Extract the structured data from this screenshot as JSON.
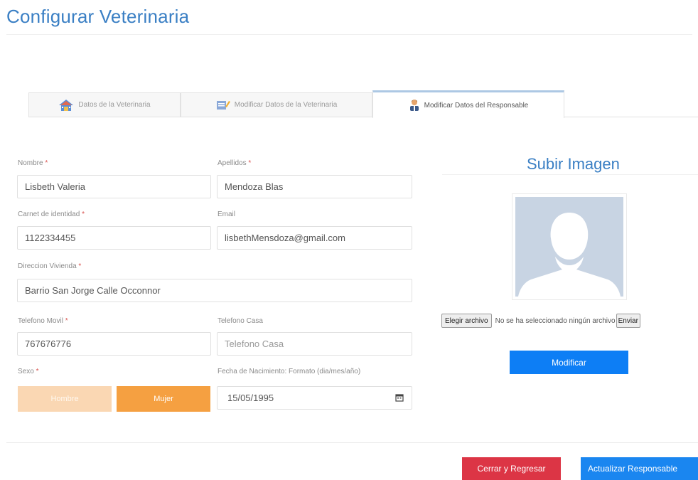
{
  "page": {
    "title": "Configurar Veterinaria"
  },
  "tabs": [
    {
      "label": "Datos de la Veterinaria",
      "icon": "house-icon",
      "active": false
    },
    {
      "label": "Modificar Datos de la Veterinaria",
      "icon": "edit-document-icon",
      "active": false
    },
    {
      "label": "Modificar Datos del Responsable",
      "icon": "user-icon",
      "active": true
    }
  ],
  "form": {
    "nombre": {
      "label": "Nombre",
      "value": "Lisbeth Valeria",
      "required": "*"
    },
    "apellidos": {
      "label": "Apellidos",
      "value": "Mendoza Blas",
      "required": "*"
    },
    "carnet": {
      "label": "Carnet de identidad",
      "value": "1122334455",
      "required": "*"
    },
    "email": {
      "label": "Email",
      "value": "lisbethMensdoza@gmail.com"
    },
    "direccion": {
      "label": "Direccion Vivienda",
      "value": "Barrio San Jorge Calle Occonnor",
      "required": "*"
    },
    "telefono_movil": {
      "label": "Telefono Movil",
      "value": "767676776",
      "required": "*"
    },
    "telefono_casa": {
      "label": "Telefono Casa",
      "placeholder": "Telefono Casa"
    },
    "sexo": {
      "label": "Sexo",
      "required": "*",
      "options": [
        "Hombre",
        "Mujer"
      ],
      "selected": "Mujer"
    },
    "fecha_nacimiento": {
      "label": "Fecha de Nacimiento: Formato (dia/mes/año)",
      "value": "15/05/1995"
    }
  },
  "upload": {
    "title": "Subir Imagen",
    "choose_label": "Elegir archivo",
    "no_file_text": "No se ha seleccionado ningún archivo",
    "send_label": "Enviar",
    "modify_label": "Modificar"
  },
  "footer": {
    "close_label": "Cerrar y Regresar",
    "update_label": "Actualizar Responsable"
  },
  "colors": {
    "title_blue": "#3a7fc4",
    "accent_orange": "#f5a041",
    "primary_blue": "#0d7ef5",
    "danger_red": "#dc3545"
  }
}
